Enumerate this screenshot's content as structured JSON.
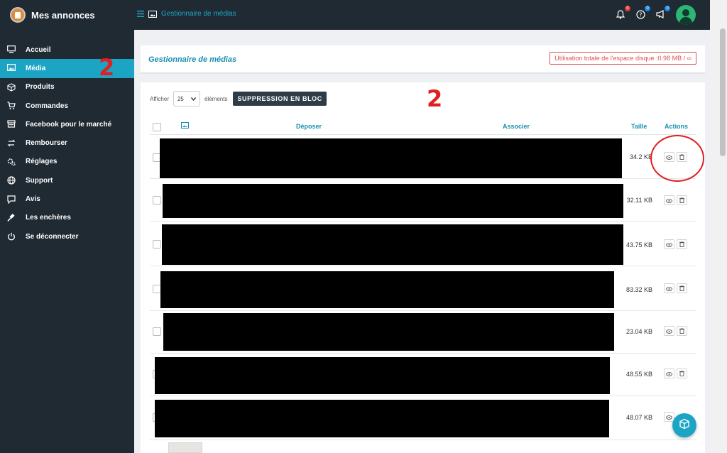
{
  "app": {
    "title": "Mes annonces"
  },
  "breadcrumb": {
    "label": "Gestionnaire de médias"
  },
  "notifications": {
    "bell_count": "0",
    "help_count": "0",
    "announce_count": "0"
  },
  "sidebar": {
    "items": [
      {
        "label": "Accueil",
        "icon": "monitor-icon"
      },
      {
        "label": "Média",
        "icon": "image-icon",
        "active": true
      },
      {
        "label": "Produits",
        "icon": "box-icon"
      },
      {
        "label": "Commandes",
        "icon": "cart-icon"
      },
      {
        "label": "Facebook pour le marché",
        "icon": "store-icon"
      },
      {
        "label": "Rembourser",
        "icon": "refund-icon"
      },
      {
        "label": "Réglages",
        "icon": "gears-icon"
      },
      {
        "label": "Support",
        "icon": "globe-icon"
      },
      {
        "label": "Avis",
        "icon": "comment-icon"
      },
      {
        "label": "Les enchères",
        "icon": "gavel-icon"
      },
      {
        "label": "Se déconnecter",
        "icon": "power-icon"
      }
    ]
  },
  "header": {
    "title": "Gestionnaire de médias",
    "disk_usage": "Utilisation totale de l'espace disque :0.98 MB / ∞"
  },
  "controls": {
    "show_label": "Afficher",
    "page_size": "25",
    "elements_label": "éléments",
    "bulk_delete_label": "SUPPRESSION EN BLOC"
  },
  "table": {
    "columns": {
      "upload": "Déposer",
      "associate": "Associer",
      "size": "Taille",
      "actions": "Actions"
    },
    "rows": [
      {
        "size": "34.2 KB"
      },
      {
        "size": "32.11 KB"
      },
      {
        "size": "43.75 KB"
      },
      {
        "size": "83.32 KB"
      },
      {
        "size": "23.04 KB"
      },
      {
        "size": "48.55 KB"
      },
      {
        "size": "48.07 KB"
      }
    ]
  },
  "annotations": {
    "number": "2"
  },
  "colors": {
    "sidebar_bg": "#1f2a33",
    "accent": "#1ba4c4",
    "annotation_red": "#e02020"
  }
}
